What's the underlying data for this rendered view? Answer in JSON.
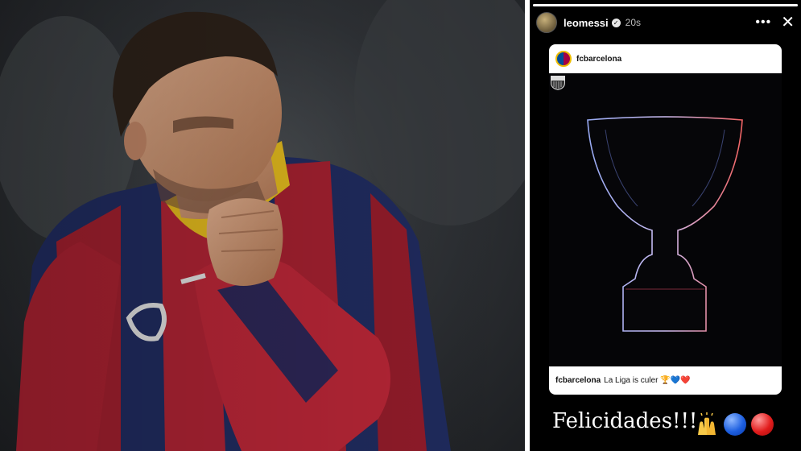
{
  "photo": {
    "jersey_text": "Q"
  },
  "story": {
    "username": "leomessi",
    "verified_mark": "✓",
    "time": "20s",
    "more_label": "•••",
    "close_label": "✕",
    "post": {
      "user": "fcbarcelona",
      "caption_user": "fcbarcelona",
      "caption_text": "La Liga is culer",
      "caption_emojis": "🏆💙❤️"
    },
    "message": "Felicidades!!!"
  },
  "colors": {
    "blaugrana_blue": "#004d98",
    "blaugrana_red": "#a50044",
    "gold": "#edbb00"
  }
}
